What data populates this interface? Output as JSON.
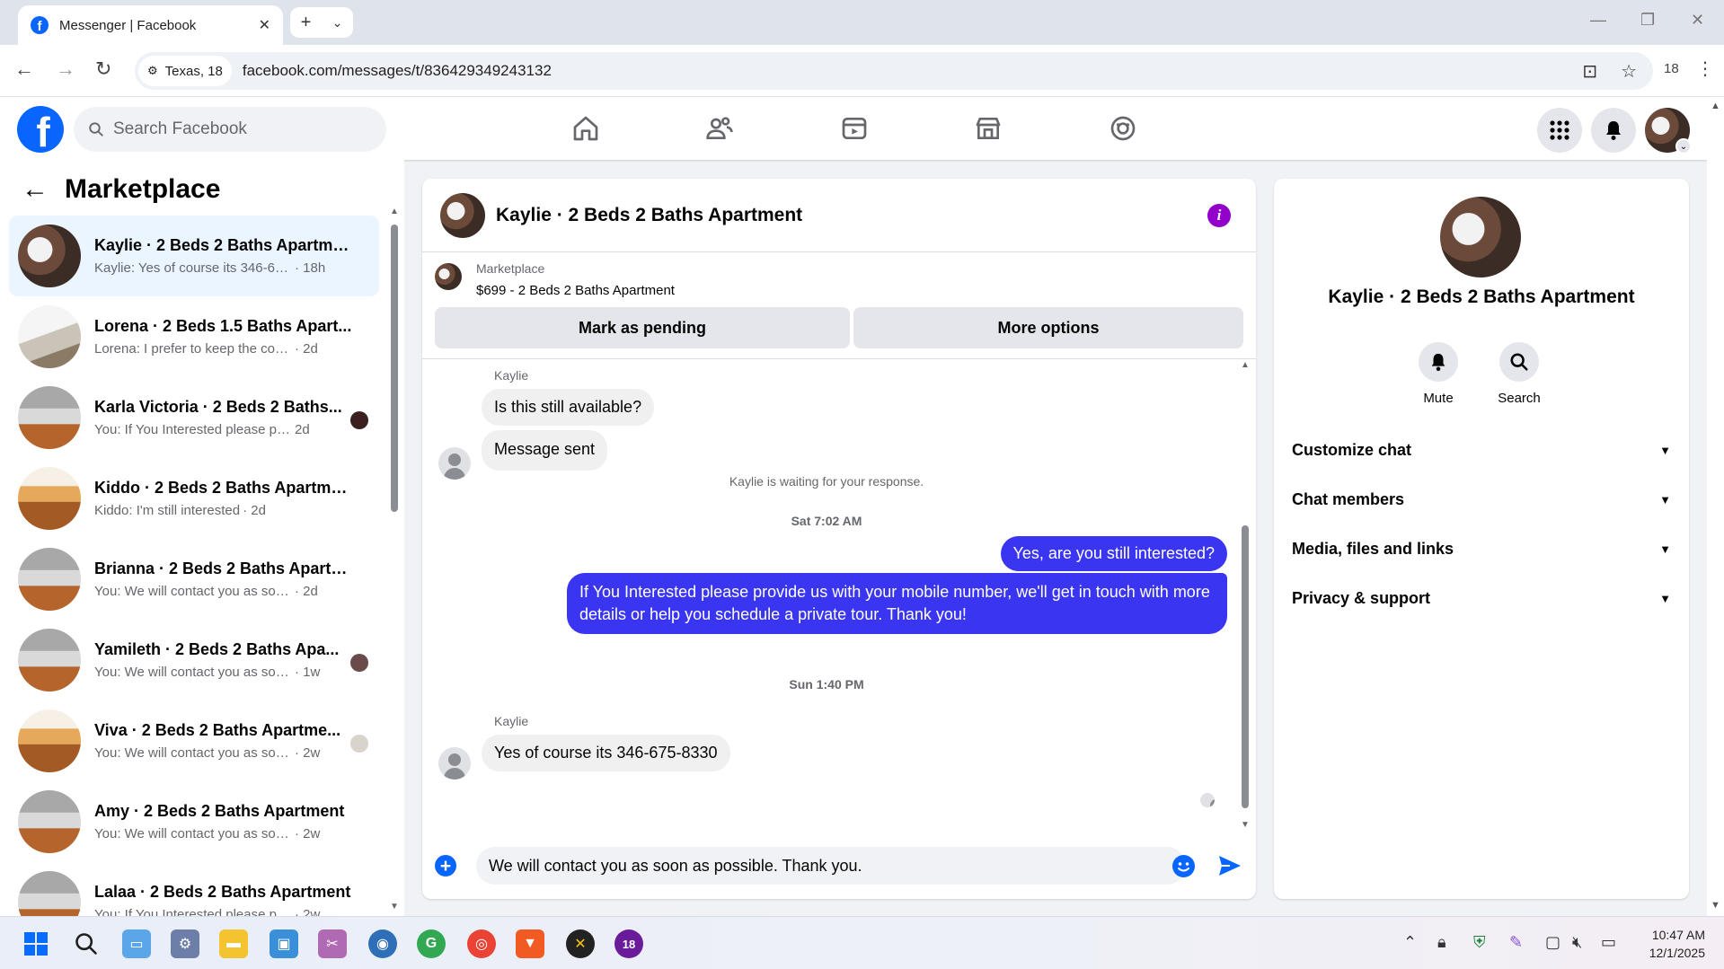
{
  "browser": {
    "tab_title": "Messenger | Facebook",
    "location_chip": "Texas, 18",
    "url": "facebook.com/messages/t/836429349243132",
    "profile_badge": "18"
  },
  "fb": {
    "search_placeholder": "Search Facebook"
  },
  "sidebar": {
    "title": "Marketplace",
    "conversations": [
      {
        "name": "Kaylie · 2 Beds 2 Baths Apartment",
        "preview": "Kaylie: Yes of course its 346-675-8...",
        "time": "· 18h",
        "active": true
      },
      {
        "name": "Lorena · 2 Beds 1.5 Baths Apart...",
        "preview": "Lorena: I prefer to keep the contact...",
        "time": "· 2d"
      },
      {
        "name": "Karla Victoria · 2 Beds 2 Baths...",
        "preview": "You: If You Interested please pro...",
        "time": " 2d"
      },
      {
        "name": "Kiddo · 2 Beds 2 Baths Apartment",
        "preview": "Kiddo: I'm still interested",
        "time": "· 2d"
      },
      {
        "name": "Brianna · 2 Beds 2 Baths Apartm...",
        "preview": "You: We will contact you as soon as...",
        "time": "· 2d"
      },
      {
        "name": "Yamileth · 2 Beds 2 Baths Apa...",
        "preview": "You: We will contact you as soo...",
        "time": " · 1w"
      },
      {
        "name": "Viva · 2 Beds 2 Baths Apartme...",
        "preview": "You: We will contact you as soo...",
        "time": " · 2w"
      },
      {
        "name": "Amy · 2 Beds 2 Baths Apartment",
        "preview": "You: We will contact you as soon a...",
        "time": " · 2w"
      },
      {
        "name": "Lalaa · 2 Beds 2 Baths Apartment",
        "preview": "You: If You Interested please provid...",
        "time": " · 2w"
      }
    ]
  },
  "chat": {
    "title": "Kaylie · 2 Beds 2 Baths Apartment",
    "listing_source": "Marketplace",
    "listing_price": "$699 - 2 Beds 2 Baths Apartment",
    "mark_pending_label": "Mark as pending",
    "more_options_label": "More options",
    "sender_name": "Kaylie",
    "msg_in_1": "Is this still available?",
    "msg_in_2": "Message sent",
    "waiting_note": "Kaylie is waiting for your response.",
    "time_1": "Sat 7:02 AM",
    "msg_out_1": "Yes, are you still interested?",
    "msg_out_2": "If You Interested please provide us with your mobile number, we'll get in touch with more details or help you schedule a private tour. Thank you!",
    "time_2": "Sun 1:40 PM",
    "sender_name_2": "Kaylie",
    "msg_in_3": "Yes of course its 346-675-8330",
    "composer_value": "We will contact you as soon as possible. Thank you."
  },
  "info": {
    "name": "Kaylie · 2 Beds 2 Baths Apartment",
    "mute_label": "Mute",
    "search_label": "Search",
    "sections": [
      "Customize chat",
      "Chat members",
      "Media, files and links",
      "Privacy & support"
    ]
  },
  "taskbar": {
    "time": "10:47 AM",
    "date": "12/1/2025",
    "badge": "18"
  },
  "colors": {
    "fb_blue": "#0866ff",
    "outgoing_bubble": "#3a35f0",
    "info_icon": "#9300cc"
  }
}
